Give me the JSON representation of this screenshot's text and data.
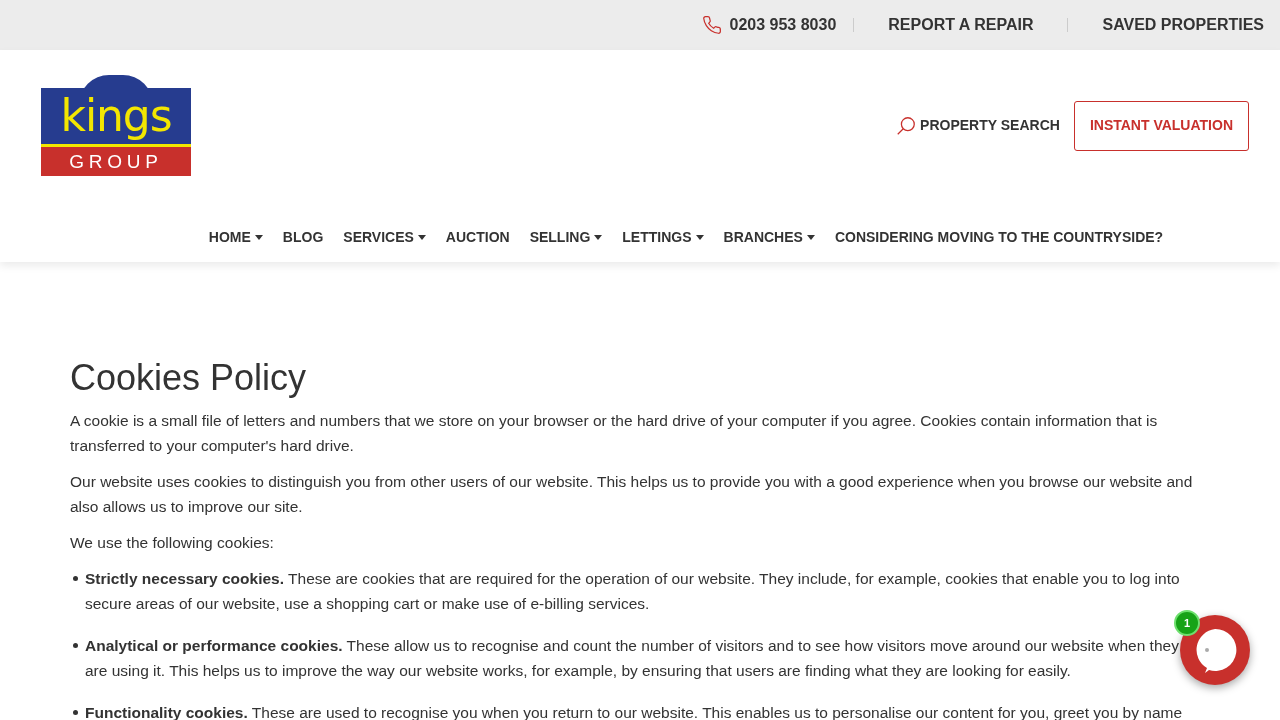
{
  "top_bar": {
    "phone": "0203 953 8030",
    "links": [
      "REPORT A REPAIR",
      "SAVED PROPERTIES"
    ]
  },
  "logo": {
    "word": "kings",
    "subword": "GROUP"
  },
  "header_actions": {
    "search": "PROPERTY SEARCH",
    "valuation": "INSTANT VALUATION"
  },
  "nav": [
    {
      "label": "HOME",
      "dropdown": true
    },
    {
      "label": "BLOG",
      "dropdown": false
    },
    {
      "label": "SERVICES",
      "dropdown": true
    },
    {
      "label": "AUCTION",
      "dropdown": false
    },
    {
      "label": "SELLING",
      "dropdown": true
    },
    {
      "label": "LETTINGS",
      "dropdown": true
    },
    {
      "label": "BRANCHES",
      "dropdown": true
    },
    {
      "label": "CONSIDERING MOVING TO THE COUNTRYSIDE?",
      "dropdown": false
    }
  ],
  "page": {
    "title": "Cookies Policy",
    "paragraphs": [
      "A cookie is a small file of letters and numbers that we store on your browser or the hard drive of your computer if you agree. Cookies contain information that is transferred to your computer's hard drive.",
      "Our website uses cookies to distinguish you from other users of our website. This helps us to provide you with a good experience when you browse our website and also allows us to improve our site.",
      "We use the following cookies:"
    ],
    "bullets": [
      "**Strictly necessary cookies.** These are cookies that are required for the operation of our website. They include, for example, cookies that enable you to log into secure areas of our website, use a shopping cart or make use of e-billing services.",
      "**Analytical or performance cookies.** These allow us to recognise and count the number of visitors and to see how visitors move around our website when they are using it. This helps us to improve the way our website works, for example, by ensuring that users are finding what they are looking for easily.",
      "**Functionality cookies.** These are used to recognise you when you return to our website. This enables us to personalise our content for you, greet you by name"
    ]
  },
  "chat": {
    "badge": "1"
  }
}
